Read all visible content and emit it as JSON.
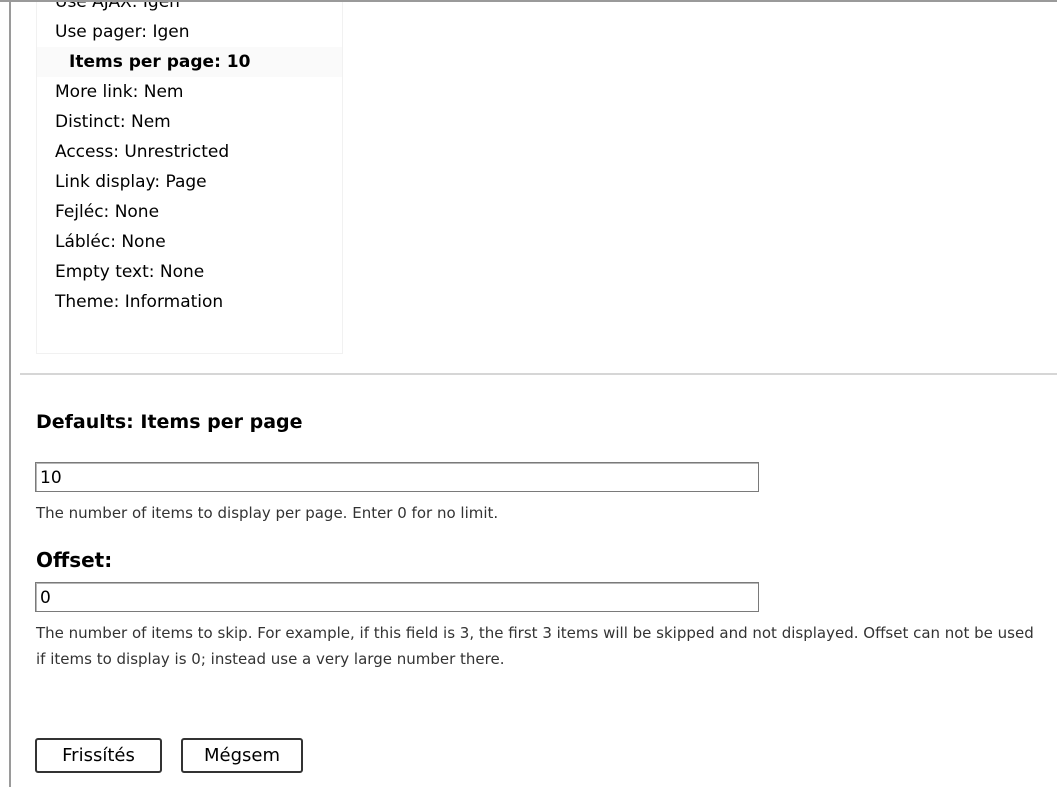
{
  "settings": {
    "items": [
      {
        "label": "Use AJAX: Igen"
      },
      {
        "label": "Use pager: Igen"
      },
      {
        "label": "Items per page: 10",
        "active": true
      },
      {
        "label": "More link: Nem"
      },
      {
        "label": "Distinct: Nem"
      },
      {
        "label": "Access: Unrestricted"
      },
      {
        "label": "Link display: Page"
      },
      {
        "label": "Fejléc: None"
      },
      {
        "label": "Lábléc: None"
      },
      {
        "label": "Empty text: None"
      },
      {
        "label": "Theme: Information"
      }
    ]
  },
  "form": {
    "title": "Defaults: Items per page",
    "items_per_page": {
      "value": "10",
      "description": "The number of items to display per page. Enter 0 for no limit."
    },
    "offset": {
      "label": "Offset:",
      "value": "0",
      "description": "The number of items to skip. For example, if this field is 3, the first 3 items will be skipped and not displayed. Offset can not be used if items to display is 0; instead use a very large number there."
    },
    "buttons": {
      "update": "Frissítés",
      "cancel": "Mégsem"
    }
  }
}
